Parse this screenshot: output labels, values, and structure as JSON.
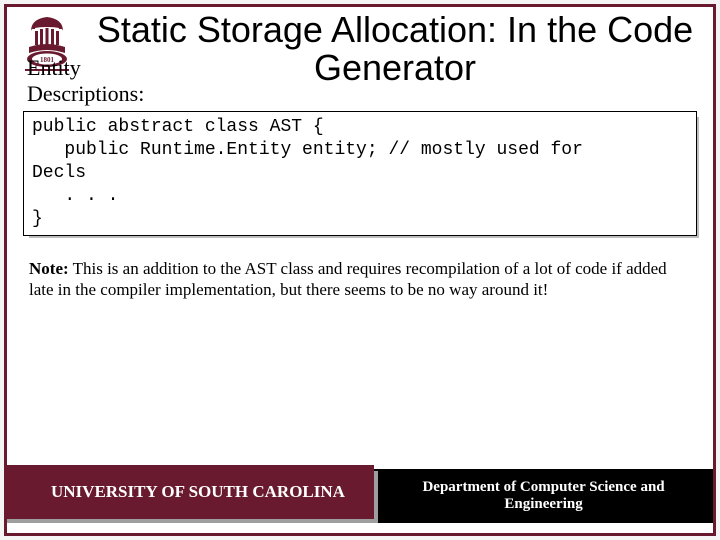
{
  "title": "Static Storage Allocation: In the Code Generator",
  "subhead_line1": "Entity",
  "subhead_line2": "Descriptions:",
  "code": "public abstract class AST {\n   public Runtime.Entity entity; // mostly used for\nDecls\n   . . .\n}",
  "note_label": "Note:",
  "note_body": " This is an addition to the AST class and requires recompilation of a lot of code if added late in the compiler implementation, but there seems to be no way around it!",
  "footer_left": "UNIVERSITY OF SOUTH CAROLINA",
  "footer_right": "Department of Computer Science and Engineering",
  "colors": {
    "garnet": "#6a1a2e",
    "black": "#000000"
  },
  "logo": {
    "name": "usc-seal",
    "year": "1801"
  }
}
